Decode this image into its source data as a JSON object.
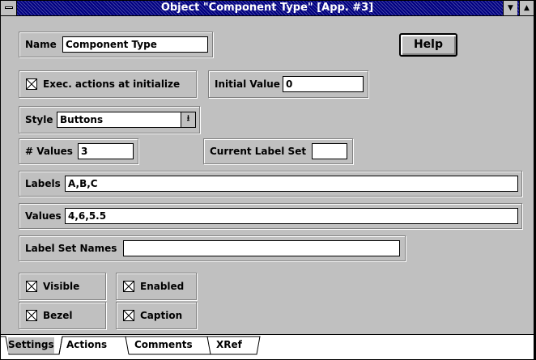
{
  "window": {
    "title": "Object \"Component Type\" [App. #3]"
  },
  "form": {
    "name_label": "Name",
    "name_value": "Component Type",
    "help_label": "Help",
    "exec_label": "Exec. actions at initialize",
    "exec_checked": true,
    "initial_value_label": "Initial Value",
    "initial_value": "0",
    "style_label": "Style",
    "style_value": "Buttons",
    "num_values_label": "# Values",
    "num_values": "3",
    "current_label_set_label": "Current Label Set",
    "current_label_set": "",
    "labels_label": "Labels",
    "labels_value": "A,B,C",
    "values_label": "Values",
    "values_value": "4,6,5.5",
    "label_set_names_label": "Label Set Names",
    "label_set_names": "",
    "visible_label": "Visible",
    "enabled_label": "Enabled",
    "bezel_label": "Bezel",
    "caption_label": "Caption"
  },
  "tabs": [
    "Settings",
    "Actions",
    "Comments",
    "XRef"
  ],
  "icons": {
    "system_menu": "system-menu-icon",
    "minimize": "minimize-arrow-icon",
    "maximize": "maximize-arrow-icon",
    "dropdown": "dropdown-arrow-icon",
    "check": "x-check-icon"
  }
}
